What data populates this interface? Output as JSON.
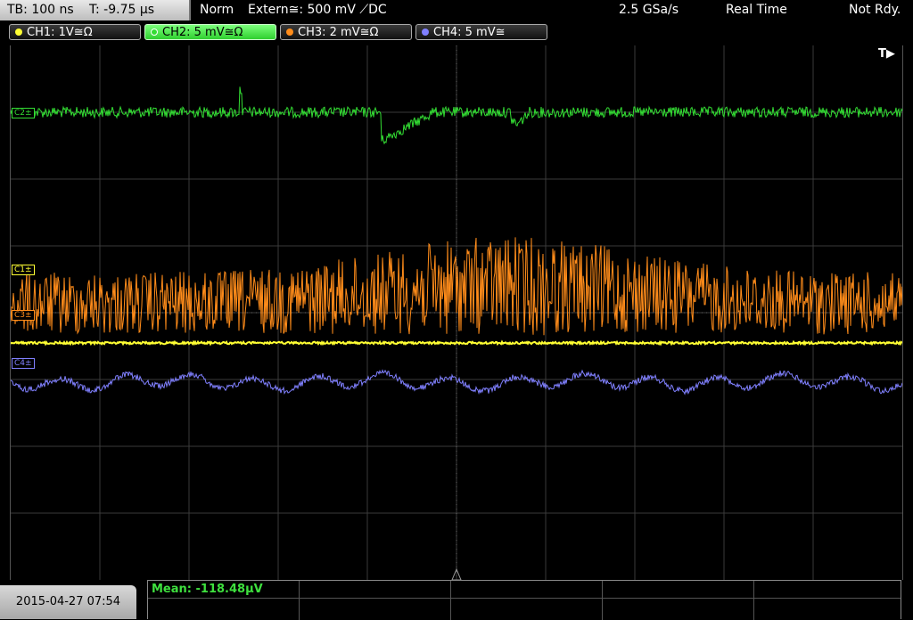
{
  "topbar": {
    "timebase": "TB: 100 ns",
    "trigger_time": "T: -9.75 µs",
    "mode": "Norm",
    "trigger_source": "Extern≅: 500 mV ⟋DC",
    "sample_rate": "2.5 GSa/s",
    "acq_mode": "Real Time",
    "status": "Not Rdy."
  },
  "channels": [
    {
      "label": "CH1: 1V≅Ω",
      "color": "#ffff33",
      "marker": "C1±"
    },
    {
      "label": "CH2: 5 mV≅Ω",
      "color": "#33dd33",
      "marker": "C2±"
    },
    {
      "label": "CH3: 2 mV≅Ω",
      "color": "#ff8c1a",
      "marker": "C3±"
    },
    {
      "label": "CH4: 5 mV≅",
      "color": "#8080ff",
      "marker": "C4±"
    }
  ],
  "trigger_flag": "T▶",
  "bottom": {
    "datetime": "2015-04-27 07:54",
    "measurement": "Mean: -118.48µV"
  },
  "colors": {
    "grid": "#3a3a3a",
    "grid_center": "#666666"
  }
}
